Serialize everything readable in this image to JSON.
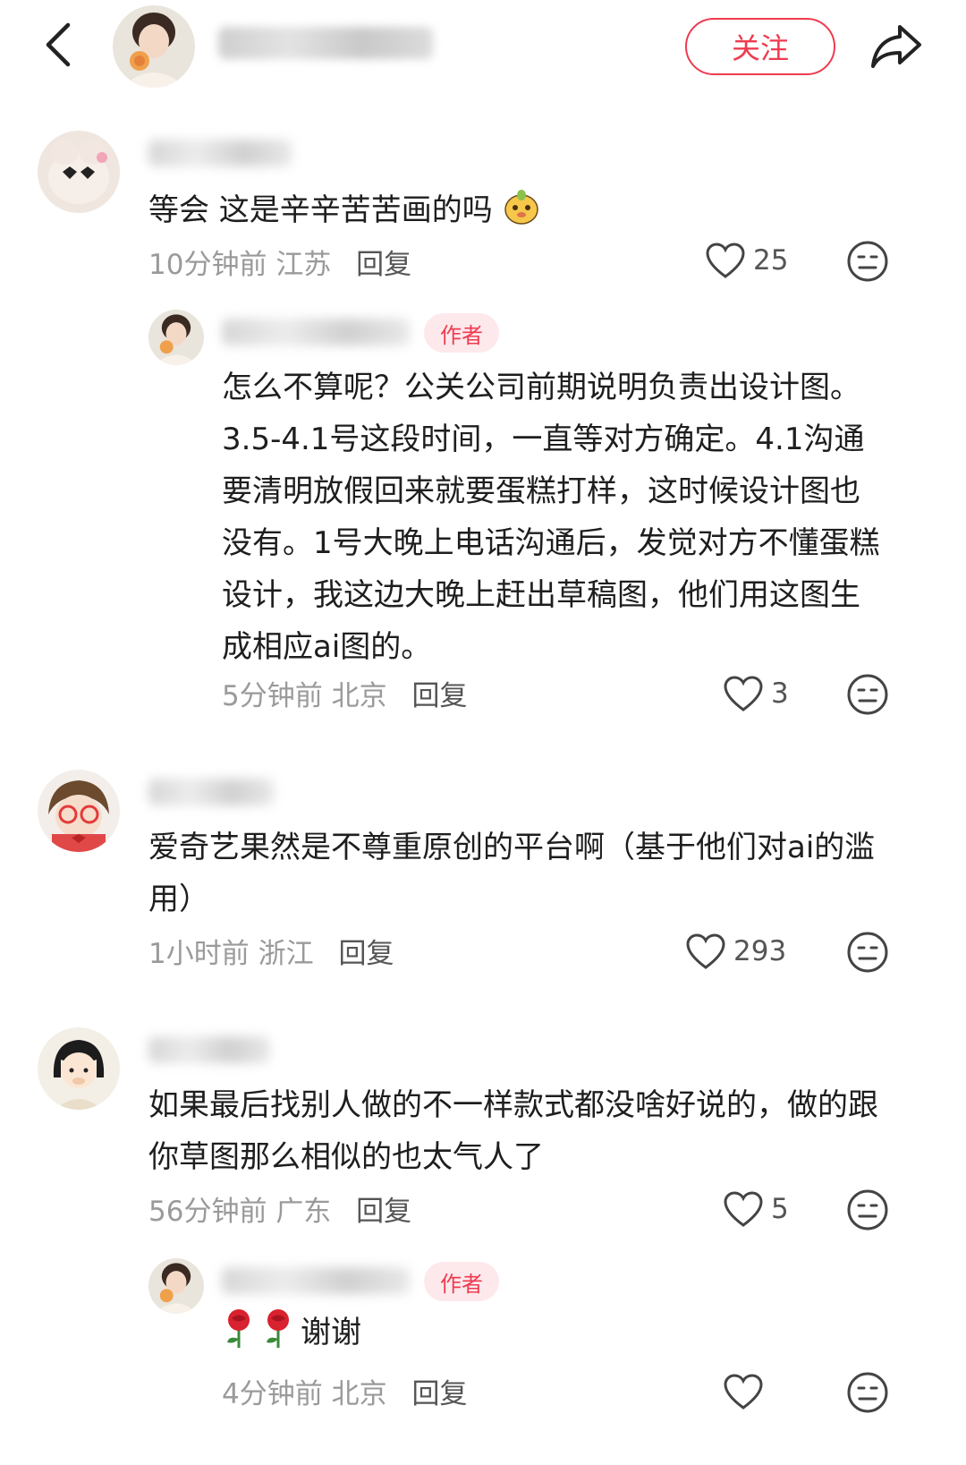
{
  "header": {
    "follow_label": "关注"
  },
  "comments": [
    {
      "text": "等会 这是辛辛苦苦画的吗",
      "time": "10分钟前",
      "location": "江苏",
      "reply_label": "回复",
      "likes": "25"
    },
    {
      "badge": "作者",
      "text": "怎么不算呢？公关公司前期说明负责出设计图。3.5-4.1号这段时间，一直等对方确定。4.1沟通要清明放假回来就要蛋糕打样，这时候设计图也没有。1号大晚上电话沟通后，发觉对方不懂蛋糕设计，我这边大晚上赶出草稿图，他们用这图生成相应ai图的。",
      "time": "5分钟前",
      "location": "北京",
      "reply_label": "回复",
      "likes": "3"
    },
    {
      "text": "爱奇艺果然是不尊重原创的平台啊（基于他们对ai的滥用）",
      "time": "1小时前",
      "location": "浙江",
      "reply_label": "回复",
      "likes": "293"
    },
    {
      "text": "如果最后找别人做的不一样款式都没啥好说的，做的跟你草图那么相似的也太气人了",
      "time": "56分钟前",
      "location": "广东",
      "reply_label": "回复",
      "likes": "5"
    },
    {
      "badge": "作者",
      "text": "谢谢",
      "time": "4分钟前",
      "location": "北京",
      "reply_label": "回复"
    }
  ],
  "icons": {
    "back": "chevron-left-icon",
    "share": "share-arrow-icon",
    "like": "heart-outline-icon",
    "dislike": "neutral-face-icon"
  },
  "colors": {
    "accent": "#ef3b50",
    "badge_bg": "#fde9ec",
    "meta_gray": "#9a9a9a"
  }
}
